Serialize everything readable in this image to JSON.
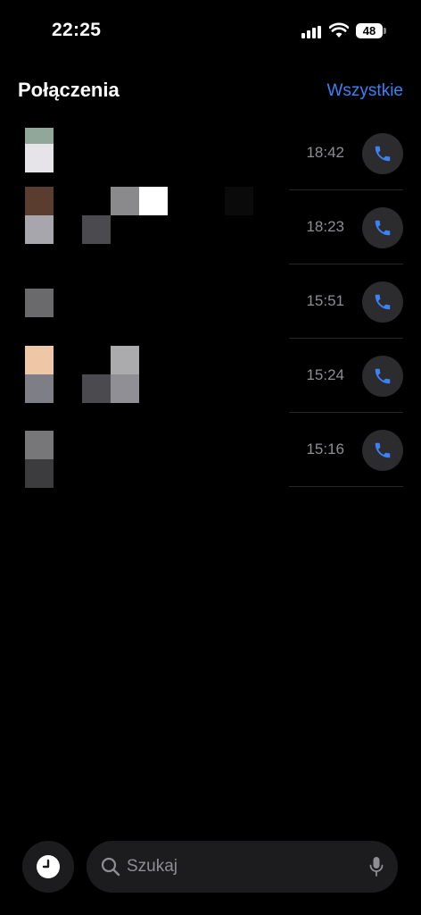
{
  "status_bar": {
    "time": "22:25",
    "battery": "48"
  },
  "header": {
    "title": "Połączenia",
    "filter_label": "Wszystkie"
  },
  "calls": [
    {
      "time": "18:42"
    },
    {
      "time": "18:23"
    },
    {
      "time": "15:51"
    },
    {
      "time": "15:24"
    },
    {
      "time": "15:16"
    }
  ],
  "search": {
    "placeholder": "Szukaj"
  },
  "colors": {
    "accent": "#3b82f6",
    "secondary_text": "#8e8e93",
    "button_bg": "#2c2c2e"
  }
}
